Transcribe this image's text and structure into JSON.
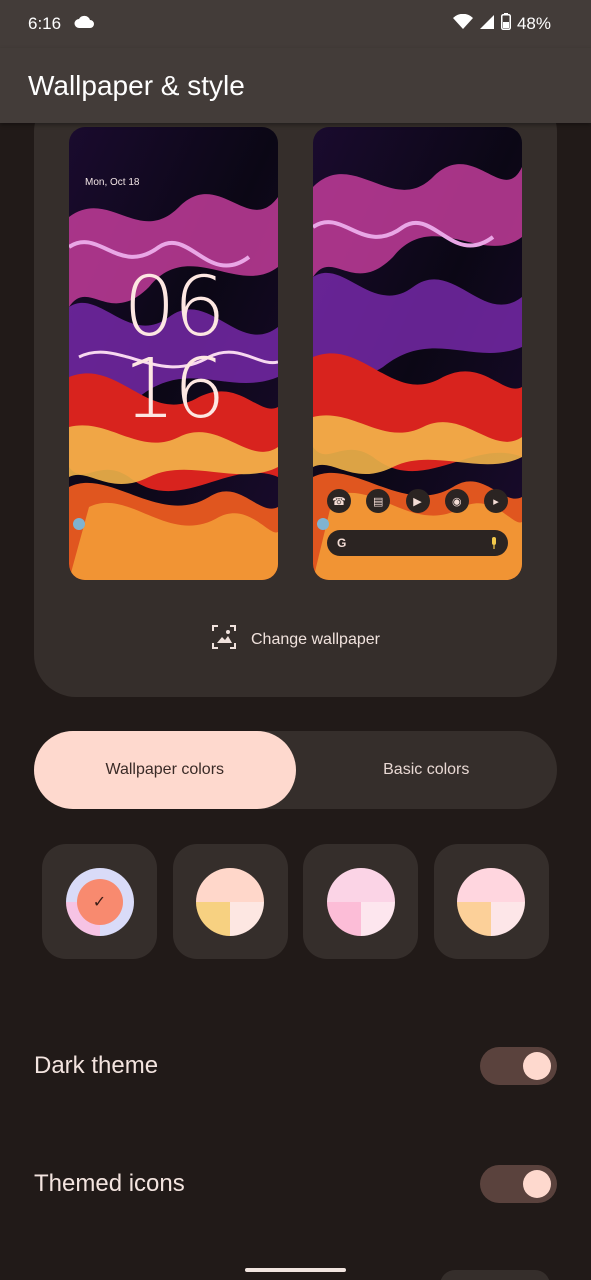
{
  "status_bar": {
    "time": "6:16",
    "battery": "48%",
    "icons": [
      "cloud-icon",
      "wifi-icon",
      "signal-icon",
      "battery-icon"
    ]
  },
  "app_bar": {
    "title": "Wallpaper & style"
  },
  "preview": {
    "lock_screen": {
      "date": "Mon, Oct 18",
      "clock_hours": "06",
      "clock_minutes": "16"
    },
    "home_screen": {
      "dock_apps": [
        "phone-icon",
        "messages-icon",
        "play-store-icon",
        "chrome-icon",
        "youtube-icon"
      ],
      "search_logo": "G",
      "mic_icon": "mic-icon"
    },
    "change_wallpaper_label": "Change wallpaper"
  },
  "color_tabs": {
    "wallpaper_colors": "Wallpaper colors",
    "basic_colors": "Basic colors",
    "active": "wallpaper_colors"
  },
  "swatches": [
    {
      "selected": true,
      "colors": [
        "#d9dbf8",
        "#f6c3e4",
        "#f88a6f"
      ]
    },
    {
      "selected": false,
      "colors": [
        "#ffd7ca",
        "#f7d181",
        "#fde7e2"
      ]
    },
    {
      "selected": false,
      "colors": [
        "#fbd4e6",
        "#fcbdd7",
        "#fde6ee"
      ]
    },
    {
      "selected": false,
      "colors": [
        "#ffd6df",
        "#fcd099",
        "#fde6e8"
      ]
    }
  ],
  "settings": {
    "dark_theme": {
      "label": "Dark theme",
      "enabled": true
    },
    "themed_icons": {
      "label": "Themed icons",
      "enabled": true
    }
  },
  "theme": {
    "background": "#211a18",
    "surface": "#352e2b",
    "accent": "#fed9ce",
    "toggle_track": "#5a423d"
  }
}
